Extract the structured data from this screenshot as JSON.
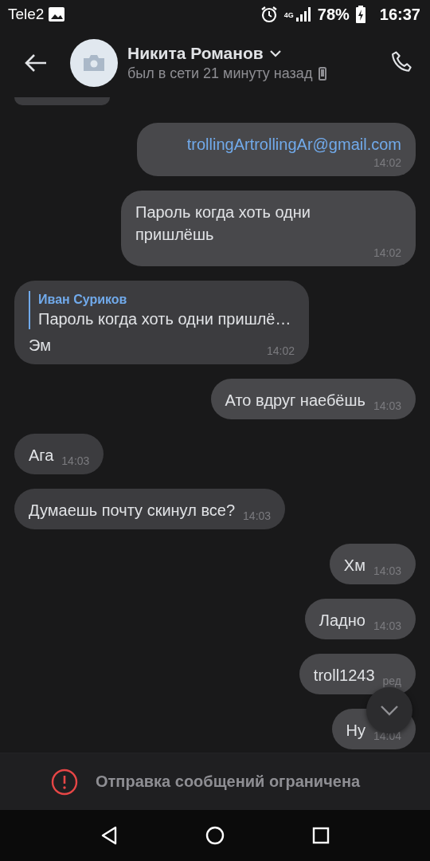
{
  "status_bar": {
    "carrier": "Tele2",
    "network": "4G",
    "battery": "78%",
    "time": "16:37"
  },
  "header": {
    "name": "Никита Романов",
    "status": "был в сети 21 минуту назад"
  },
  "messages": [
    {
      "outgoing": false,
      "kind": "cut"
    },
    {
      "outgoing": true,
      "kind": "link",
      "text": "trollingArtrollingAr@gmail.com",
      "time": "14:02"
    },
    {
      "outgoing": true,
      "kind": "text",
      "text": "Пароль когда хоть одни пришлёшь",
      "time": "14:02"
    },
    {
      "outgoing": false,
      "kind": "reply",
      "reply_author": "Иван Суриков",
      "reply_text": "Пароль когда хоть одни пришлё…",
      "text": "Эм",
      "time": "14:02"
    },
    {
      "outgoing": true,
      "kind": "text",
      "text": "Ато вдруг наебёшь",
      "time": "14:03"
    },
    {
      "outgoing": false,
      "kind": "text",
      "text": "Ага",
      "time": "14:03"
    },
    {
      "outgoing": false,
      "kind": "text",
      "text": "Думаешь почту скинул все?",
      "time": "14:03"
    },
    {
      "outgoing": true,
      "kind": "text",
      "text": "Хм",
      "time": "14:03"
    },
    {
      "outgoing": true,
      "kind": "text",
      "text": "Ладно",
      "time": "14:03"
    },
    {
      "outgoing": true,
      "kind": "text",
      "text": "troll1243",
      "time": "ред"
    },
    {
      "outgoing": true,
      "kind": "text",
      "text": "Ну",
      "time": "14:04"
    }
  ],
  "notice": "Отправка сообщений ограничена"
}
